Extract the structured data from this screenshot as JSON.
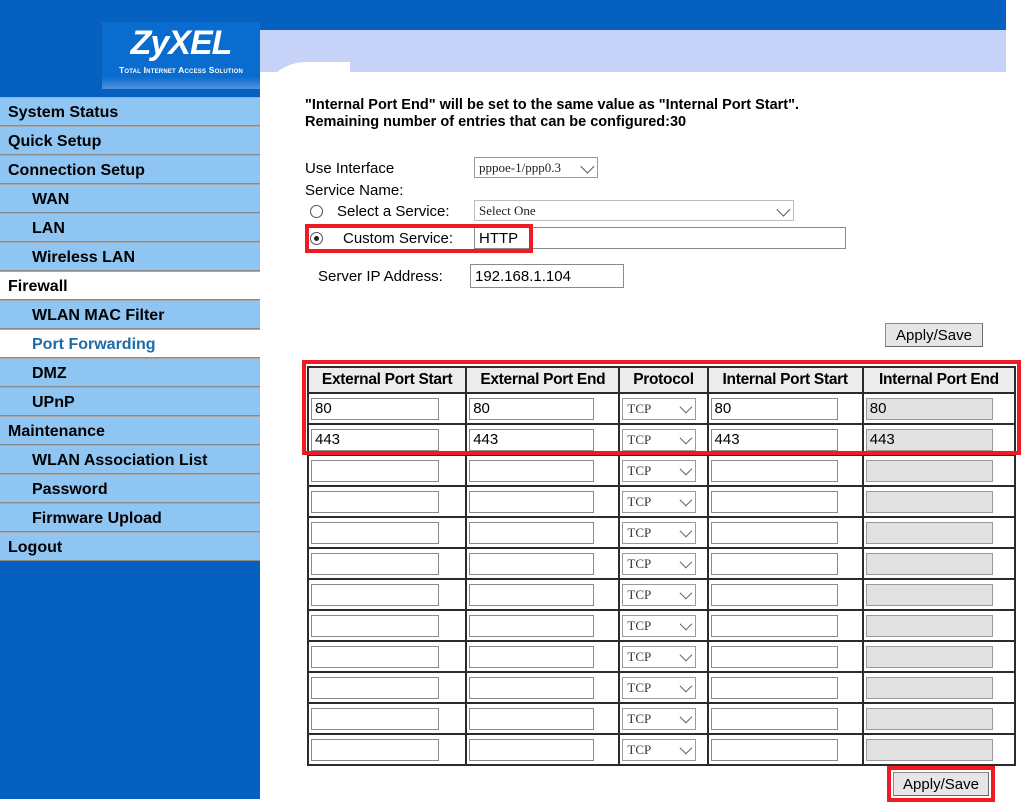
{
  "branding": {
    "logo_text": "ZyXEL",
    "logo_tagline": "Total Internet Access Solution"
  },
  "sidebar": {
    "items": [
      {
        "label": "System Status",
        "level": 0,
        "state": "normal"
      },
      {
        "label": "Quick Setup",
        "level": 0,
        "state": "normal"
      },
      {
        "label": "Connection Setup",
        "level": 0,
        "state": "normal"
      },
      {
        "label": "WAN",
        "level": 1,
        "state": "normal"
      },
      {
        "label": "LAN",
        "level": 1,
        "state": "normal"
      },
      {
        "label": "Wireless LAN",
        "level": 1,
        "state": "normal"
      },
      {
        "label": "Firewall",
        "level": 0,
        "state": "white"
      },
      {
        "label": "WLAN MAC Filter",
        "level": 1,
        "state": "normal"
      },
      {
        "label": "Port Forwarding",
        "level": 1,
        "state": "active"
      },
      {
        "label": "DMZ",
        "level": 1,
        "state": "normal"
      },
      {
        "label": "UPnP",
        "level": 1,
        "state": "normal"
      },
      {
        "label": "Maintenance",
        "level": 0,
        "state": "normal"
      },
      {
        "label": "WLAN Association List",
        "level": 1,
        "state": "normal"
      },
      {
        "label": "Password",
        "level": 1,
        "state": "normal"
      },
      {
        "label": "Firmware Upload",
        "level": 1,
        "state": "normal"
      },
      {
        "label": "Logout",
        "level": 0,
        "state": "normal"
      }
    ]
  },
  "main": {
    "notice_line1": "\"Internal Port End\" will be set to the same value as \"Internal Port Start\".",
    "notice_line2": "Remaining number of entries that can be configured:30",
    "use_interface_label": "Use Interface",
    "use_interface_value": "pppoe-1/ppp0.3",
    "service_name_label": "Service Name:",
    "select_service_label": "Select a Service:",
    "select_service_value": "Select One",
    "select_service_selected": false,
    "custom_service_label": "Custom Service:",
    "custom_service_value": "HTTP",
    "custom_service_selected": true,
    "server_ip_label": "Server IP Address:",
    "server_ip_value": "192.168.1.104",
    "apply_save_top": "Apply/Save",
    "apply_save_bottom": "Apply/Save"
  },
  "table": {
    "headers": [
      "External Port Start",
      "External Port End",
      "Protocol",
      "Internal Port Start",
      "Internal Port End"
    ],
    "rows": [
      {
        "ext_start": "80",
        "ext_end": "80",
        "protocol": "TCP",
        "int_start": "80",
        "int_end": "80"
      },
      {
        "ext_start": "443",
        "ext_end": "443",
        "protocol": "TCP",
        "int_start": "443",
        "int_end": "443"
      },
      {
        "ext_start": "",
        "ext_end": "",
        "protocol": "TCP",
        "int_start": "",
        "int_end": ""
      },
      {
        "ext_start": "",
        "ext_end": "",
        "protocol": "TCP",
        "int_start": "",
        "int_end": ""
      },
      {
        "ext_start": "",
        "ext_end": "",
        "protocol": "TCP",
        "int_start": "",
        "int_end": ""
      },
      {
        "ext_start": "",
        "ext_end": "",
        "protocol": "TCP",
        "int_start": "",
        "int_end": ""
      },
      {
        "ext_start": "",
        "ext_end": "",
        "protocol": "TCP",
        "int_start": "",
        "int_end": ""
      },
      {
        "ext_start": "",
        "ext_end": "",
        "protocol": "TCP",
        "int_start": "",
        "int_end": ""
      },
      {
        "ext_start": "",
        "ext_end": "",
        "protocol": "TCP",
        "int_start": "",
        "int_end": ""
      },
      {
        "ext_start": "",
        "ext_end": "",
        "protocol": "TCP",
        "int_start": "",
        "int_end": ""
      },
      {
        "ext_start": "",
        "ext_end": "",
        "protocol": "TCP",
        "int_start": "",
        "int_end": ""
      },
      {
        "ext_start": "",
        "ext_end": "",
        "protocol": "TCP",
        "int_start": "",
        "int_end": ""
      }
    ]
  },
  "colors": {
    "banner_blue": "#0560c0",
    "sidebar_item_blue": "#8fc5f2",
    "lavender": "#c6d2f7",
    "highlight_red": "#ee1b24",
    "active_link": "#1b6ca8"
  }
}
